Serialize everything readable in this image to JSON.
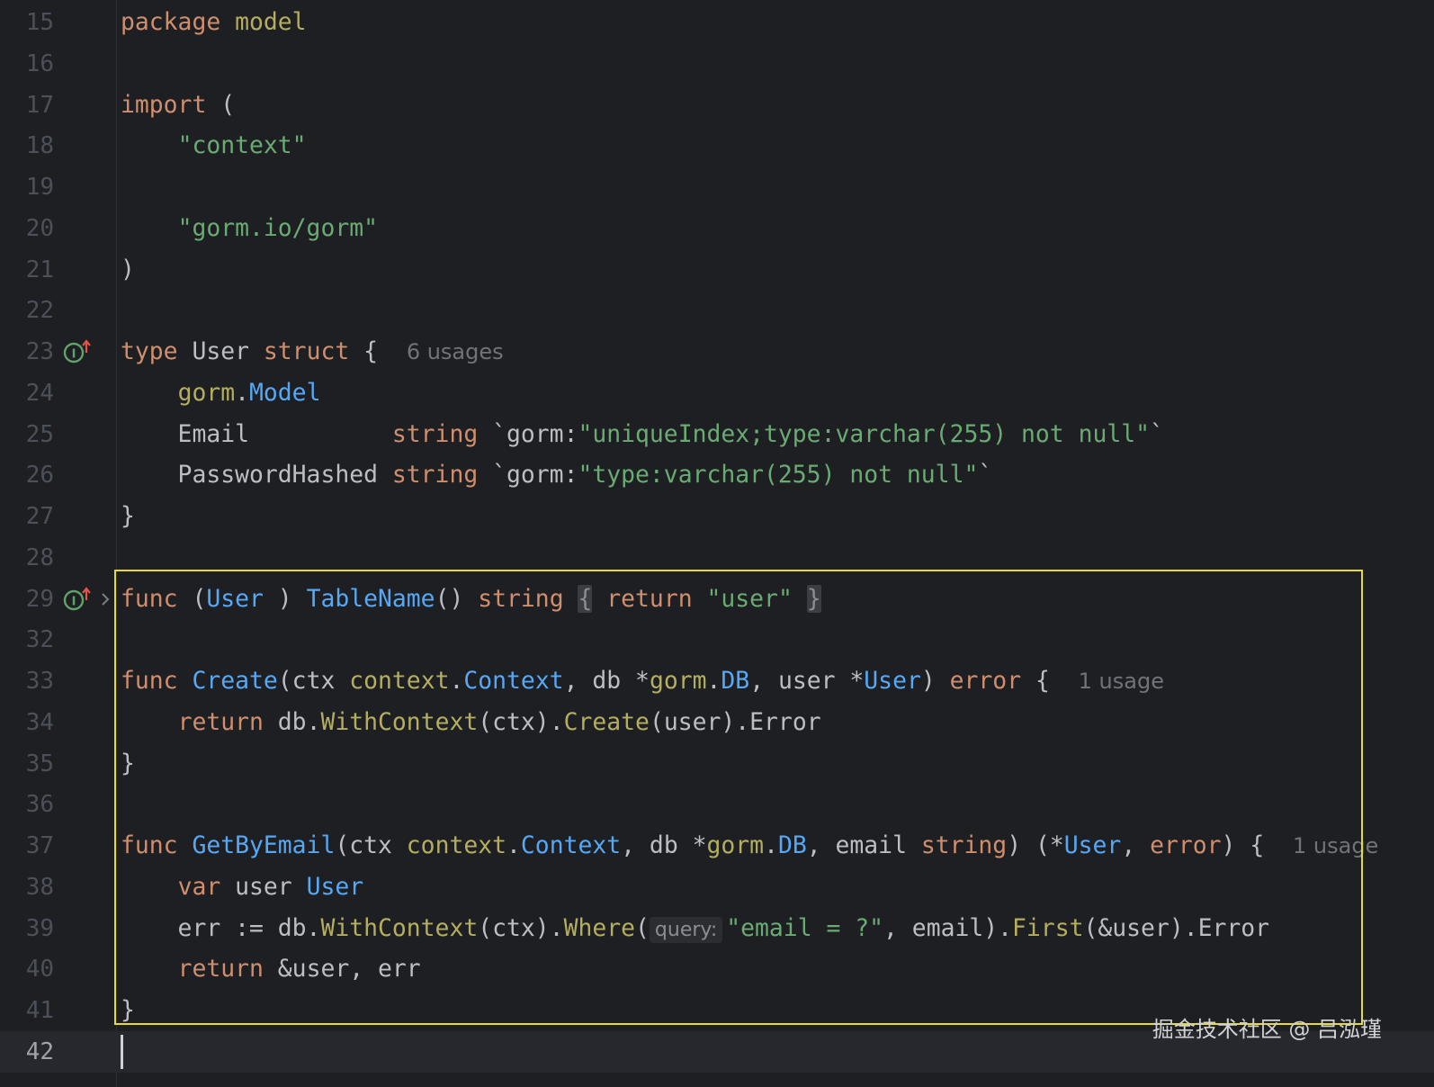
{
  "lines": [
    {
      "n": "15",
      "tokens": [
        [
          "kw",
          "package"
        ],
        [
          "",
          "",
          " "
        ],
        [
          "pkg",
          "model"
        ]
      ]
    },
    {
      "n": "16",
      "tokens": []
    },
    {
      "n": "17",
      "tokens": [
        [
          "kw",
          "import"
        ],
        [
          "",
          " ("
        ]
      ]
    },
    {
      "n": "18",
      "tokens": [
        [
          "",
          "    "
        ],
        [
          "str",
          "\"context\""
        ]
      ]
    },
    {
      "n": "19",
      "tokens": []
    },
    {
      "n": "20",
      "tokens": [
        [
          "",
          "    "
        ],
        [
          "str",
          "\"gorm.io/gorm\""
        ]
      ]
    },
    {
      "n": "21",
      "tokens": [
        [
          "",
          ")"
        ]
      ]
    },
    {
      "n": "22",
      "tokens": []
    },
    {
      "n": "23",
      "tokens": [
        [
          "kw",
          "type"
        ],
        [
          "",
          " User "
        ],
        [
          "kw",
          "struct"
        ],
        [
          "",
          " {  "
        ],
        [
          "hint",
          "6 usages"
        ]
      ]
    },
    {
      "n": "24",
      "tokens": [
        [
          "",
          "    "
        ],
        [
          "pkg",
          "gorm"
        ],
        [
          "",
          "."
        ],
        [
          "typ",
          "Model"
        ]
      ]
    },
    {
      "n": "25",
      "tokens": [
        [
          "",
          "    Email          "
        ],
        [
          "kw",
          "string"
        ],
        [
          "",
          " `gorm:"
        ],
        [
          "str",
          "\"uniqueIndex;type:varchar(255) not null\""
        ],
        [
          "",
          "`"
        ]
      ]
    },
    {
      "n": "26",
      "tokens": [
        [
          "",
          "    PasswordHashed "
        ],
        [
          "kw",
          "string"
        ],
        [
          "",
          " `gorm:"
        ],
        [
          "str",
          "\"type:varchar(255) not null\""
        ],
        [
          "",
          "`"
        ]
      ]
    },
    {
      "n": "27",
      "tokens": [
        [
          "",
          "}"
        ]
      ]
    },
    {
      "n": "28",
      "tokens": []
    },
    {
      "n": "29",
      "tokens": [
        [
          "kw",
          "func"
        ],
        [
          "",
          " ("
        ],
        [
          "typ",
          "User"
        ],
        [
          "",
          " ) "
        ],
        [
          "fn",
          "TableName"
        ],
        [
          "",
          "() "
        ],
        [
          "kw",
          "string"
        ],
        [
          "",
          " "
        ],
        [
          "brace",
          "{"
        ],
        [
          "",
          " "
        ],
        [
          "kw",
          "return"
        ],
        [
          "",
          " "
        ],
        [
          "str",
          "\"user\""
        ],
        [
          "",
          " "
        ],
        [
          "brace",
          "}"
        ]
      ]
    },
    {
      "n": "32",
      "tokens": []
    },
    {
      "n": "33",
      "tokens": [
        [
          "kw",
          "func"
        ],
        [
          "",
          " "
        ],
        [
          "fn",
          "Create"
        ],
        [
          "",
          "(ctx "
        ],
        [
          "pkg",
          "context"
        ],
        [
          "",
          "."
        ],
        [
          "typ",
          "Context"
        ],
        [
          "",
          ", db *"
        ],
        [
          "pkg",
          "gorm"
        ],
        [
          "",
          "."
        ],
        [
          "typ",
          "DB"
        ],
        [
          "",
          ", user *"
        ],
        [
          "typ",
          "User"
        ],
        [
          "",
          ") "
        ],
        [
          "kw",
          "error"
        ],
        [
          "",
          " {  "
        ],
        [
          "hint",
          "1 usage"
        ]
      ]
    },
    {
      "n": "34",
      "tokens": [
        [
          "",
          "    "
        ],
        [
          "kw",
          "return"
        ],
        [
          "",
          " db."
        ],
        [
          "fcall",
          "WithContext"
        ],
        [
          "",
          "(ctx)."
        ],
        [
          "fcall",
          "Create"
        ],
        [
          "",
          "(user).Error"
        ]
      ]
    },
    {
      "n": "35",
      "tokens": [
        [
          "",
          "}"
        ]
      ]
    },
    {
      "n": "36",
      "tokens": []
    },
    {
      "n": "37",
      "tokens": [
        [
          "kw",
          "func"
        ],
        [
          "",
          " "
        ],
        [
          "fn",
          "GetByEmail"
        ],
        [
          "",
          "(ctx "
        ],
        [
          "pkg",
          "context"
        ],
        [
          "",
          "."
        ],
        [
          "typ",
          "Context"
        ],
        [
          "",
          ", db *"
        ],
        [
          "pkg",
          "gorm"
        ],
        [
          "",
          "."
        ],
        [
          "typ",
          "DB"
        ],
        [
          "",
          ", email "
        ],
        [
          "kw",
          "string"
        ],
        [
          "",
          ") (*"
        ],
        [
          "typ",
          "User"
        ],
        [
          "",
          ", "
        ],
        [
          "kw",
          "error"
        ],
        [
          "",
          ") {  "
        ],
        [
          "hint",
          "1 usage"
        ]
      ]
    },
    {
      "n": "38",
      "tokens": [
        [
          "",
          "    "
        ],
        [
          "kw",
          "var"
        ],
        [
          "",
          " user "
        ],
        [
          "typ",
          "User"
        ]
      ]
    },
    {
      "n": "39",
      "tokens": [
        [
          "",
          "    err := db."
        ],
        [
          "fcall",
          "WithContext"
        ],
        [
          "",
          "(ctx)."
        ],
        [
          "fcall",
          "Where"
        ],
        [
          "",
          "("
        ],
        [
          "inlay",
          "query:"
        ],
        [
          "str",
          "\"email = ?\""
        ],
        [
          "",
          ", email)."
        ],
        [
          "fcall",
          "First"
        ],
        [
          "",
          "(&user).Error"
        ]
      ]
    },
    {
      "n": "40",
      "tokens": [
        [
          "",
          "    "
        ],
        [
          "kw",
          "return"
        ],
        [
          "",
          " &user, err"
        ]
      ]
    },
    {
      "n": "41",
      "tokens": [
        [
          "",
          "}"
        ]
      ]
    },
    {
      "n": "42",
      "tokens": [],
      "current": true
    }
  ],
  "gutter_icons": {
    "23": "implementation-up-icon",
    "29": "implementation-up-icon"
  },
  "fold_markers": {
    "29": "fold-expand-icon"
  },
  "watermark": "掘金技术社区 @ 吕泓瑾",
  "colors": {
    "keyword": "#cf8e6d",
    "string": "#6aab73",
    "type": "#56a8f5",
    "package": "#b3ae60",
    "highlight_box": "#e6db2e",
    "background": "#1e1f22"
  }
}
